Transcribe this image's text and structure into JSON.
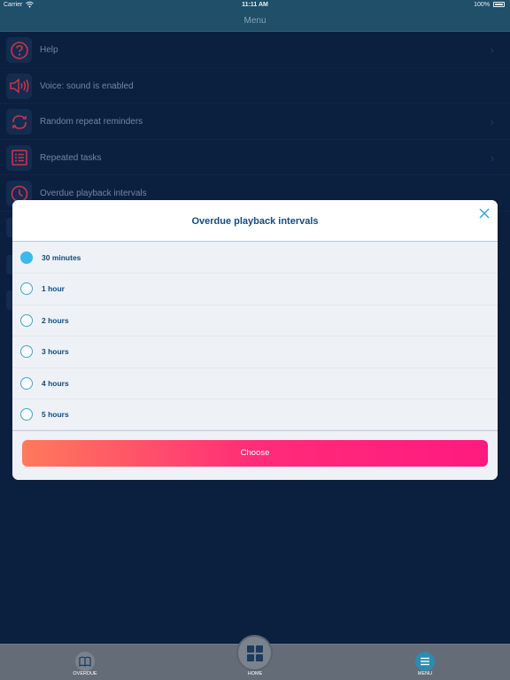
{
  "status_bar": {
    "carrier": "Carrier",
    "time": "11:11 AM",
    "battery": "100%"
  },
  "nav": {
    "title": "Menu"
  },
  "menu": {
    "items": [
      {
        "label": "Help",
        "icon": "help-icon",
        "chevron": true
      },
      {
        "label": "Voice: sound is enabled",
        "icon": "speaker-icon",
        "chevron": false
      },
      {
        "label": "Random repeat reminders",
        "icon": "repeat-icon",
        "chevron": true
      },
      {
        "label": "Repeated tasks",
        "icon": "list-icon",
        "chevron": true
      },
      {
        "label": "Overdue playback intervals",
        "icon": "clock-icon",
        "chevron": false
      }
    ]
  },
  "modal": {
    "title": "Overdue playback intervals",
    "options": [
      {
        "label": "30 minutes",
        "selected": true
      },
      {
        "label": "1 hour",
        "selected": false
      },
      {
        "label": "2 hours",
        "selected": false
      },
      {
        "label": "3 hours",
        "selected": false
      },
      {
        "label": "4 hours",
        "selected": false
      },
      {
        "label": "5 hours",
        "selected": false
      }
    ],
    "choose_label": "Choose",
    "close_icon": "close-icon"
  },
  "tabbar": {
    "overdue_label": "OVERDUE",
    "home_label": "HOME",
    "menu_label": "MENU"
  },
  "colors": {
    "background": "#0b1f3f",
    "nav": "#1f4f69",
    "icon_red": "#c8344a",
    "accent_blue": "#3ab9ea",
    "title_blue": "#174a7e",
    "button_start": "#ff7a5a",
    "button_end": "#ff1a80"
  }
}
